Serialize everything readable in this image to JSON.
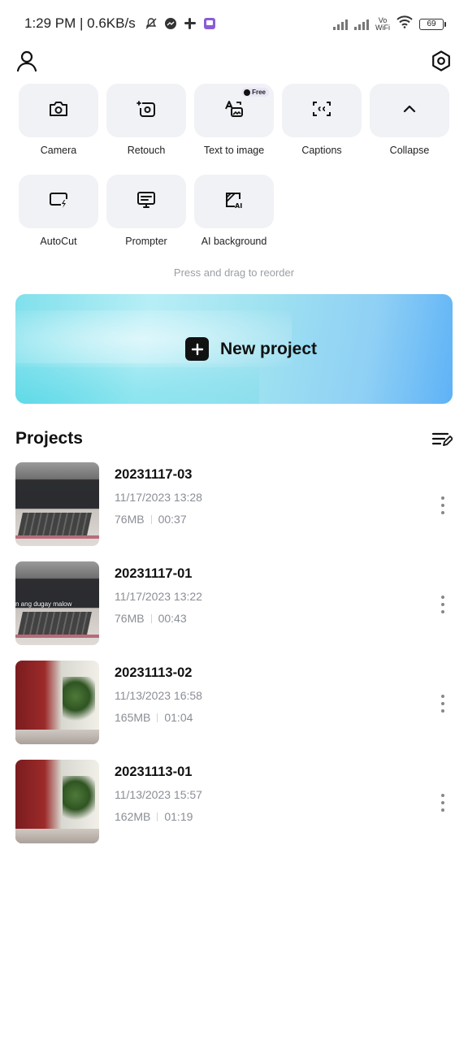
{
  "status_bar": {
    "time_speed": "1:29 PM | 0.6KB/s",
    "vowifi_top": "Vo",
    "vowifi_bottom": "WiFi",
    "battery": "69"
  },
  "tools": [
    {
      "label": "Camera",
      "icon": "camera-icon"
    },
    {
      "label": "Retouch",
      "icon": "retouch-icon"
    },
    {
      "label": "Text to image",
      "icon": "text-to-image-icon",
      "badge": "Free"
    },
    {
      "label": "Captions",
      "icon": "captions-icon"
    },
    {
      "label": "Collapse",
      "icon": "chevron-up-icon"
    },
    {
      "label": "AutoCut",
      "icon": "autocut-icon"
    },
    {
      "label": "Prompter",
      "icon": "prompter-icon"
    },
    {
      "label": "AI background",
      "icon": "ai-background-icon"
    }
  ],
  "hint": "Press and drag to reorder",
  "new_project": {
    "label": "New project"
  },
  "projects": {
    "title": "Projects",
    "items": [
      {
        "name": "20231117-03",
        "date": "11/17/2023 13:28",
        "size": "76MB",
        "duration": "00:37"
      },
      {
        "name": "20231117-01",
        "date": "11/17/2023 13:22",
        "size": "76MB",
        "duration": "00:43",
        "thumb_caption": "n ang dugay malow"
      },
      {
        "name": "20231113-02",
        "date": "11/13/2023 16:58",
        "size": "165MB",
        "duration": "01:04"
      },
      {
        "name": "20231113-01",
        "date": "11/13/2023 15:57",
        "size": "162MB",
        "duration": "01:19"
      }
    ]
  },
  "colors": {
    "accent": "#111111",
    "tile_bg": "#f0f2f5",
    "muted_text": "#8a8e95"
  }
}
